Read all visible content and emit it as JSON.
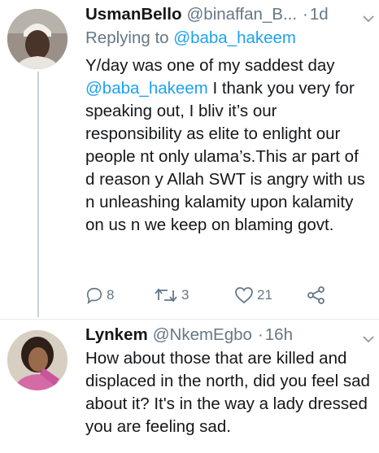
{
  "tweet1": {
    "name": "UsmanBello",
    "handle": "@binaffan_B...",
    "separator": "·",
    "time": "1d",
    "replying_prefix": "Replying to",
    "replying_to": "@baba_hakeem",
    "text_lead": "Y/day was one of my saddest day",
    "text_mention": "@baba_hakeem",
    "text_rest": " I thank you very for speaking out, I bliv it’s our responsibility as elite to enlight our people nt only ulama’s.This ar part of d reason y Allah SWT is angry with us n unleashing kalamity upon kalamity on us n we keep on blaming govt.",
    "replies": "8",
    "retweets": "3",
    "likes": "21",
    "icons": [
      "reply-icon",
      "retweet-icon",
      "like-icon",
      "share-icon",
      "chevron-down-icon"
    ]
  },
  "tweet2": {
    "name": "Lynkem",
    "handle": "@NkemEgbo",
    "separator": "·",
    "time": "16h",
    "text": "How about those that are killed and displaced in the north, did you feel sad about it? It's in the way a lady dressed you are feeling sad."
  },
  "colors": {
    "text": "#14171a",
    "secondary": "#657786",
    "link": "#1da1f2",
    "thread_line": "#c8d1d8"
  }
}
